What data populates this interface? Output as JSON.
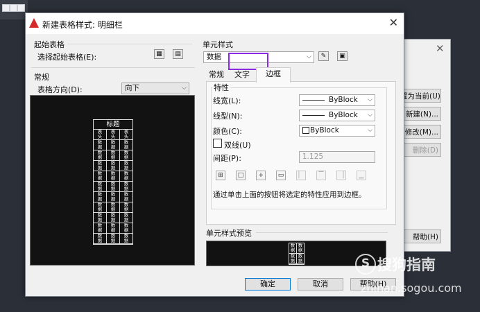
{
  "background_dialog": {
    "buttons": [
      "置为当前(U)",
      "新建(N)...",
      "修改(M)...",
      "删除(D)"
    ],
    "help_button": "帮助(H)"
  },
  "dialog": {
    "title": "新建表格样式: 明细栏",
    "start_table": {
      "section": "起始表格",
      "label": "选择起始表格(E):"
    },
    "general": {
      "section": "常规",
      "direction_label": "表格方向(D):",
      "direction_value": "向下"
    },
    "preview_table": {
      "header": "标题",
      "column_headers": [
        "表\n头",
        "表\n头",
        "表\n头"
      ],
      "data_cell": "数\n据",
      "data_rows": 10
    },
    "cell_style": {
      "section": "单元样式",
      "value": "数据",
      "tabs": [
        "常规",
        "文字",
        "边框"
      ],
      "active_tab": "边框"
    },
    "properties": {
      "group": "特性",
      "lineweight_label": "线宽(L):",
      "lineweight_value": "ByBlock",
      "linetype_label": "线型(N):",
      "linetype_value": "ByBlock",
      "color_label": "颜色(C):",
      "color_value": "ByBlock",
      "double_line_label": "双线(U)",
      "double_line_checked": false,
      "spacing_label": "间距(P):",
      "spacing_value": "1.125",
      "border_buttons": [
        "all-borders-icon",
        "outside-borders-icon",
        "inside-borders-icon",
        "no-border-icon",
        "left-border-icon",
        "top-border-icon",
        "right-border-icon",
        "bottom-border-icon"
      ],
      "hint": "通过单击上面的按钮将选定的特性应用到边框。"
    },
    "cell_preview": {
      "section": "单元样式预览",
      "cell": "数\n据"
    },
    "buttons": {
      "ok": "确定",
      "cancel": "取消",
      "help": "帮助(H)"
    },
    "colors": {
      "highlight": "#8a2be2",
      "title_icon": "#d42a2a",
      "default_button_border": "#0078d7"
    }
  },
  "watermark": {
    "brand": "搜狗指南",
    "url": "zhinan.sogou.com",
    "logo_letter": "S"
  }
}
